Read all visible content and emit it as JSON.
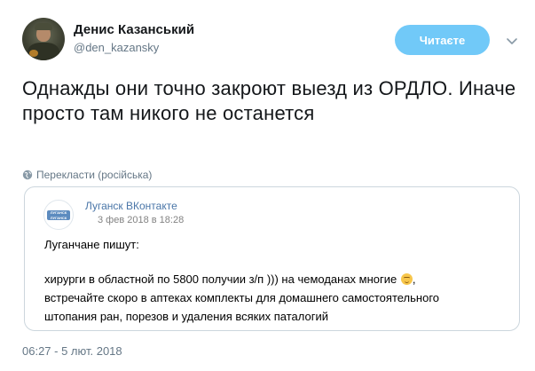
{
  "author": {
    "name": "Денис Казанський",
    "handle": "@den_kazansky",
    "avatar_icon": "user-avatar-photo"
  },
  "follow_button": {
    "label": "Читаєте",
    "color": "#71c9f8"
  },
  "menu_icon": "chevron-down-icon",
  "tweet_text": "Однажды они точно закроют выезд из ОРДЛО. Иначе просто там никого не останется",
  "translate": {
    "icon": "globe-icon",
    "label": "Перекласти (російська)"
  },
  "quoted": {
    "source_name": "Луганск ВКонтакте",
    "source_date": "3 фев 2018 в 18:28",
    "logo_text": "ЛУГАНСК ЛУГАНСК",
    "line1": "Луганчане пишут:",
    "line2_before_emoji": "хирурги в областной по 5800 получии з/п ))) на чемоданах многие ",
    "emoji_icon": "smirking-face-emoji",
    "line2_after_emoji": ",",
    "line3": "встречайте скоро в аптеках комплекты для домашнего самостоятельного",
    "line4": "штопания ран, порезов и удаления всяких паталогий",
    "link_color": "#4a76a8"
  },
  "timestamp": "06:27 - 5 лют. 2018"
}
